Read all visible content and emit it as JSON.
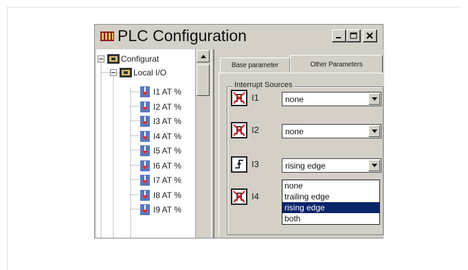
{
  "window": {
    "title": "PLC Configuration",
    "buttons": {
      "minimize": "_",
      "maximize": "□",
      "close": "×"
    }
  },
  "tree": {
    "root": "Configurat",
    "local_io": "Local I/O",
    "items": [
      "I1 AT %",
      "I2 AT %",
      "I3 AT %",
      "I4 AT %",
      "I5 AT %",
      "I6 AT %",
      "I7 AT %",
      "I8 AT %",
      "I9 AT %"
    ]
  },
  "tabs": {
    "base": "Base parameter",
    "other": "Other Parameters"
  },
  "interrupt": {
    "group_label": "Interrupt Sources",
    "rows": [
      {
        "label": "I1",
        "value": "none",
        "icon": "disabled-edge-icon"
      },
      {
        "label": "I2",
        "value": "none",
        "icon": "disabled-edge-icon"
      },
      {
        "label": "I3",
        "value": "rising edge",
        "icon": "rising-edge-icon"
      },
      {
        "label": "I4",
        "value": "",
        "icon": "disabled-edge-icon"
      }
    ],
    "dropdown_options": [
      "none",
      "trailing edge",
      "rising edge",
      "both"
    ],
    "dropdown_selected": "rising edge"
  },
  "colors": {
    "selection": "#0a246a",
    "window_bg": "#d4d0c8"
  }
}
